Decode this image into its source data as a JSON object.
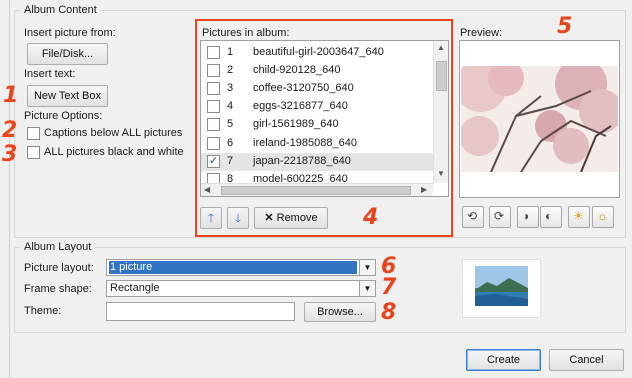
{
  "album_content": {
    "title": "Album Content",
    "insert_picture_label": "Insert picture from:",
    "file_disk_button": "File/Disk...",
    "insert_text_label": "Insert text:",
    "new_text_box_button": "New Text Box",
    "picture_options_label": "Picture Options:",
    "captions_option": "Captions below ALL pictures",
    "bw_option": "ALL pictures black and white",
    "pictures_in_album_label": "Pictures in album:",
    "pictures": [
      {
        "num": "1",
        "name": "beautiful-girl-2003647_640",
        "checked": false,
        "selected": false
      },
      {
        "num": "2",
        "name": "child-920128_640",
        "checked": false,
        "selected": false
      },
      {
        "num": "3",
        "name": "coffee-3120750_640",
        "checked": false,
        "selected": false
      },
      {
        "num": "4",
        "name": "eggs-3216877_640",
        "checked": false,
        "selected": false
      },
      {
        "num": "5",
        "name": "girl-1561989_640",
        "checked": false,
        "selected": false
      },
      {
        "num": "6",
        "name": "ireland-1985088_640",
        "checked": false,
        "selected": false
      },
      {
        "num": "7",
        "name": "japan-2218788_640",
        "checked": true,
        "selected": true
      },
      {
        "num": "8",
        "name": "model-600225_640",
        "checked": false,
        "selected": false
      }
    ],
    "remove_button": "Remove",
    "preview_label": "Preview:"
  },
  "album_layout": {
    "title": "Album Layout",
    "picture_layout_label": "Picture layout:",
    "picture_layout_value": "1 picture",
    "frame_shape_label": "Frame shape:",
    "frame_shape_value": "Rectangle",
    "theme_label": "Theme:",
    "theme_value": "",
    "browse_button": "Browse..."
  },
  "footer": {
    "create_button": "Create",
    "cancel_button": "Cancel"
  },
  "annotations": [
    "1",
    "2",
    "3",
    "4",
    "5",
    "6",
    "7",
    "8"
  ],
  "colors": {
    "annotation": "#e8451c",
    "selection": "#3174c4",
    "dialog_bg": "#f0f0f0"
  }
}
